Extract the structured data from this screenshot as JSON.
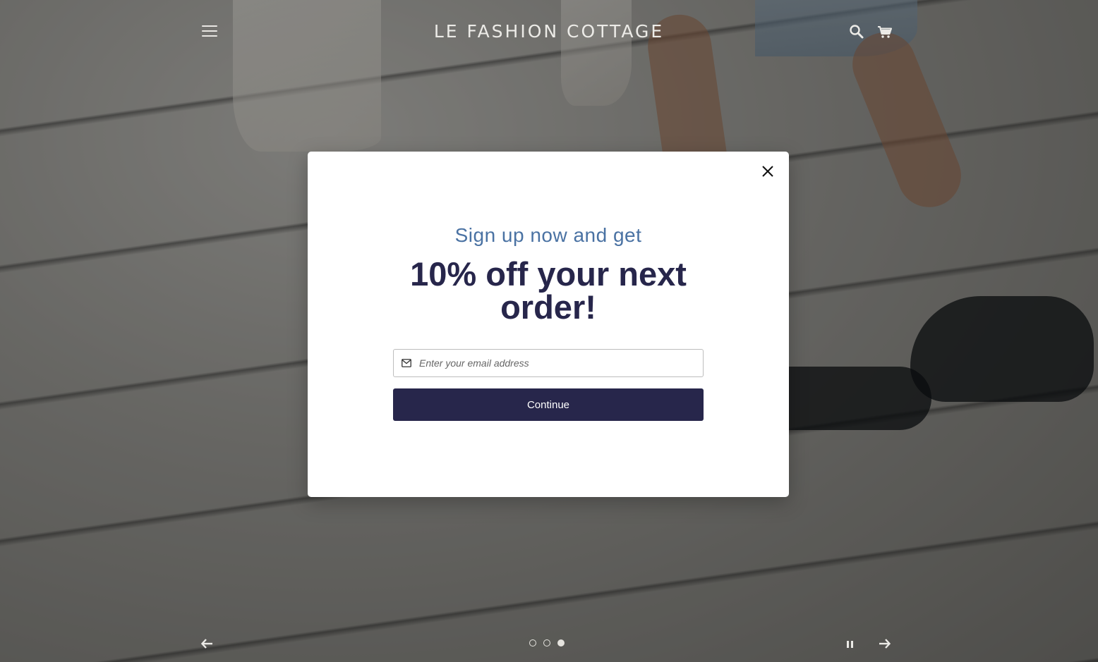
{
  "header": {
    "logo_text": "LE FASHION COTTAGE",
    "menu_icon": "hamburger-menu-icon",
    "search_icon": "search-icon",
    "cart_icon": "cart-icon"
  },
  "popup": {
    "subtitle": "Sign up now and get",
    "title": "10% off your next order!",
    "email_placeholder": "Enter your email address",
    "email_value": "",
    "continue_label": "Continue",
    "close_icon": "close-icon",
    "mail_icon": "mail-icon"
  },
  "slideshow": {
    "slide_count": 3,
    "active_slide": 3,
    "prev_icon": "arrow-left-icon",
    "next_icon": "arrow-right-icon",
    "pause_icon": "pause-icon"
  },
  "colors": {
    "brand_navy": "#27264b",
    "subtitle_blue": "#4a72a3",
    "header_text": "#ecebe7"
  }
}
